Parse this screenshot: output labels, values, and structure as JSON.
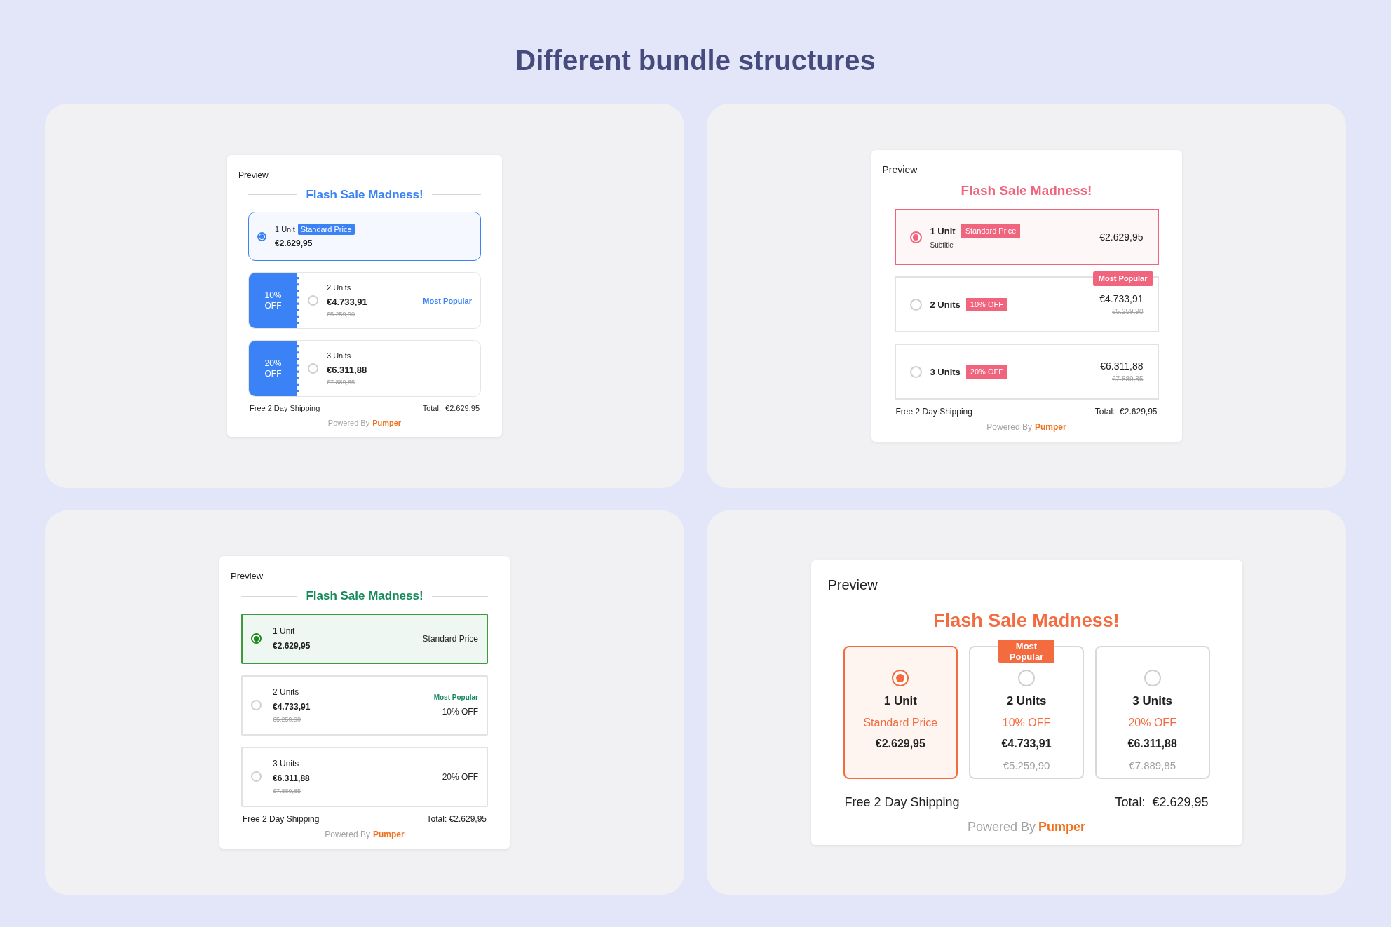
{
  "title": "Different bundle structures",
  "panels": [
    {
      "kind": "ticket",
      "color": "#3b82f6",
      "preview_label": "Preview",
      "heading": "Flash Sale Madness!",
      "shipping": "Free 2 Day Shipping",
      "total": "Total:  €2.629,95",
      "powered_by": "Powered By",
      "brand": "Pumper",
      "options": [
        {
          "units": "1 Unit",
          "tag": "Standard Price",
          "price": "€2.629,95",
          "selected": true
        },
        {
          "units": "2 Units",
          "tag": "10% OFF",
          "price": "€4.733,91",
          "old_price": "€5.259,90",
          "popular": "Most Popular",
          "selected": false
        },
        {
          "units": "3 Units",
          "tag": "20% OFF",
          "price": "€6.311,88",
          "old_price": "€7.889,85",
          "selected": false
        }
      ]
    },
    {
      "kind": "tag",
      "color": "#f0647e",
      "preview_label": "Preview",
      "heading": "Flash Sale Madness!",
      "shipping": "Free 2 Day Shipping",
      "total": "Total:  €2.629,95",
      "powered_by": "Powered By",
      "brand": "Pumper",
      "options": [
        {
          "units": "1 Unit",
          "tag": "Standard Price",
          "subtitle": "Subtitle",
          "price": "€2.629,95",
          "selected": true
        },
        {
          "units": "2 Units",
          "tag": "10% OFF",
          "price": "€4.733,91",
          "old_price": "€5.259,90",
          "popular": "Most Popular",
          "selected": false
        },
        {
          "units": "3 Units",
          "tag": "20% OFF",
          "price": "€6.311,88",
          "old_price": "€7.889,85",
          "selected": false
        }
      ]
    },
    {
      "kind": "plain",
      "color": "#168a5c",
      "preview_label": "Preview",
      "heading": "Flash Sale Madness!",
      "shipping": "Free 2 Day Shipping",
      "total": "Total: €2.629,95",
      "powered_by": "Powered By",
      "brand": "Pumper",
      "options": [
        {
          "units": "1 Unit",
          "tag": "Standard Price",
          "price": "€2.629,95",
          "selected": true
        },
        {
          "units": "2 Units",
          "tag": "10% OFF",
          "price": "€4.733,91",
          "old_price": "€5.259,90",
          "popular": "Most Popular",
          "selected": false
        },
        {
          "units": "3 Units",
          "tag": "20% OFF",
          "price": "€6.311,88",
          "old_price": "€7.889,85",
          "selected": false
        }
      ]
    },
    {
      "kind": "columns",
      "color": "#f46b3f",
      "preview_label": "Preview",
      "heading": "Flash Sale Madness!",
      "shipping": "Free 2 Day Shipping",
      "total": "Total:  €2.629,95",
      "powered_by": "Powered By",
      "brand": "Pumper",
      "options": [
        {
          "units": "1 Unit",
          "tag": "Standard Price",
          "price": "€2.629,95",
          "selected": true
        },
        {
          "units": "2 Units",
          "tag": "10% OFF",
          "price": "€4.733,91",
          "old_price": "€5.259,90",
          "popular": "Most Popular",
          "selected": false
        },
        {
          "units": "3 Units",
          "tag": "20% OFF",
          "price": "€6.311,88",
          "old_price": "€7.889,85",
          "selected": false
        }
      ]
    }
  ]
}
